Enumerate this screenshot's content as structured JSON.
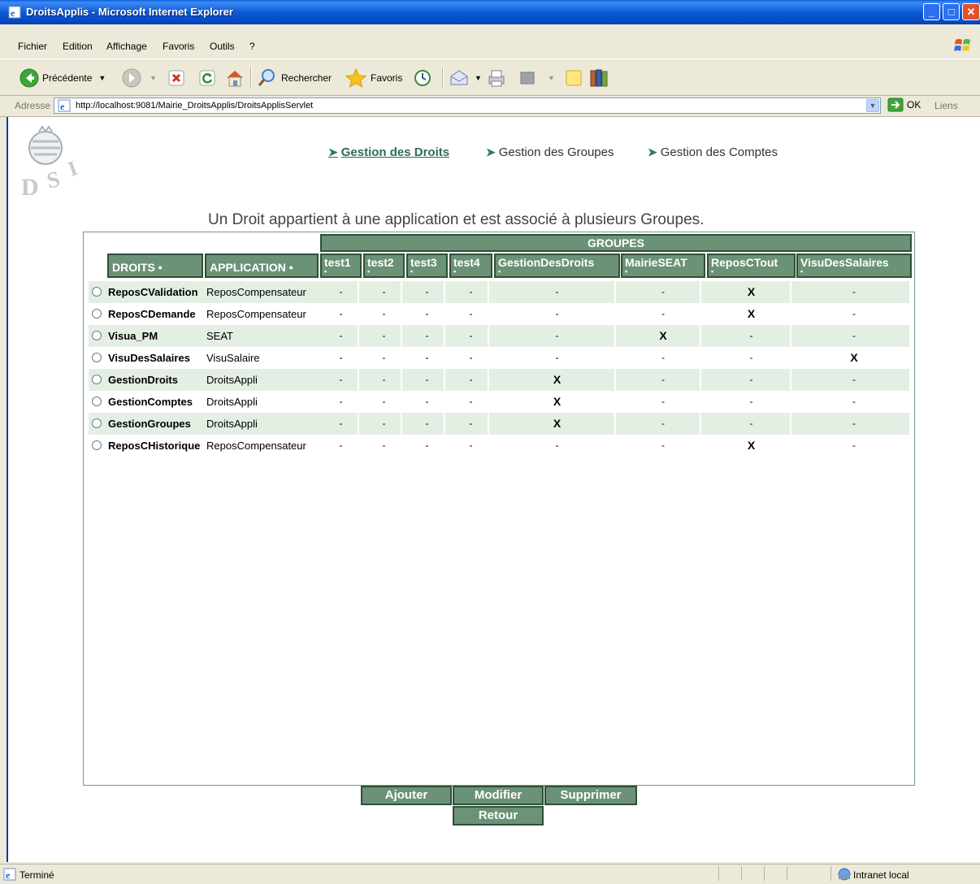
{
  "window": {
    "title": "DroitsApplis - Microsoft Internet Explorer"
  },
  "menu": [
    "Fichier",
    "Edition",
    "Affichage",
    "Favoris",
    "Outils",
    "?"
  ],
  "toolbar": {
    "back": "Précédente",
    "search": "Rechercher",
    "favorites": "Favoris"
  },
  "address": {
    "label": "Adresse",
    "url": "http://localhost:9081/Mairie_DroitsApplis/DroitsApplisServlet",
    "go": "OK",
    "links": "Liens"
  },
  "nav": [
    {
      "label": "Gestion des Droits",
      "active": true
    },
    {
      "label": "Gestion des Groupes",
      "active": false
    },
    {
      "label": "Gestion des Comptes",
      "active": false
    }
  ],
  "subtitle": "Un Droit appartient à une application et est associé à plusieurs Groupes.",
  "table": {
    "groupes_header": "GROUPES",
    "col_droits": "DROITS •",
    "col_application": "APPLICATION •",
    "groups": [
      "test1",
      "test2",
      "test3",
      "test4",
      "GestionDesDroits",
      "MairieSEAT",
      "ReposCTout",
      "VisuDesSalaires"
    ],
    "rows": [
      {
        "droit": "ReposCValidation",
        "application": "ReposCompensateur",
        "cells": [
          "-",
          "-",
          "-",
          "-",
          "-",
          "-",
          "X",
          "-"
        ]
      },
      {
        "droit": "ReposCDemande",
        "application": "ReposCompensateur",
        "cells": [
          "-",
          "-",
          "-",
          "-",
          "-",
          "-",
          "X",
          "-"
        ]
      },
      {
        "droit": "Visua_PM",
        "application": "SEAT",
        "cells": [
          "-",
          "-",
          "-",
          "-",
          "-",
          "X",
          "-",
          "-"
        ]
      },
      {
        "droit": "VisuDesSalaires",
        "application": "VisuSalaire",
        "cells": [
          "-",
          "-",
          "-",
          "-",
          "-",
          "-",
          "-",
          "X"
        ]
      },
      {
        "droit": "GestionDroits",
        "application": "DroitsAppli",
        "cells": [
          "-",
          "-",
          "-",
          "-",
          "X",
          "-",
          "-",
          "-"
        ]
      },
      {
        "droit": "GestionComptes",
        "application": "DroitsAppli",
        "cells": [
          "-",
          "-",
          "-",
          "-",
          "X",
          "-",
          "-",
          "-"
        ]
      },
      {
        "droit": "GestionGroupes",
        "application": "DroitsAppli",
        "cells": [
          "-",
          "-",
          "-",
          "-",
          "X",
          "-",
          "-",
          "-"
        ]
      },
      {
        "droit": "ReposCHistorique",
        "application": "ReposCompensateur",
        "cells": [
          "-",
          "-",
          "-",
          "-",
          "-",
          "-",
          "X",
          "-"
        ]
      }
    ]
  },
  "buttons": {
    "add": "Ajouter",
    "modify": "Modifier",
    "delete": "Supprimer",
    "back": "Retour"
  },
  "status": {
    "text": "Terminé",
    "zone": "Intranet local"
  }
}
